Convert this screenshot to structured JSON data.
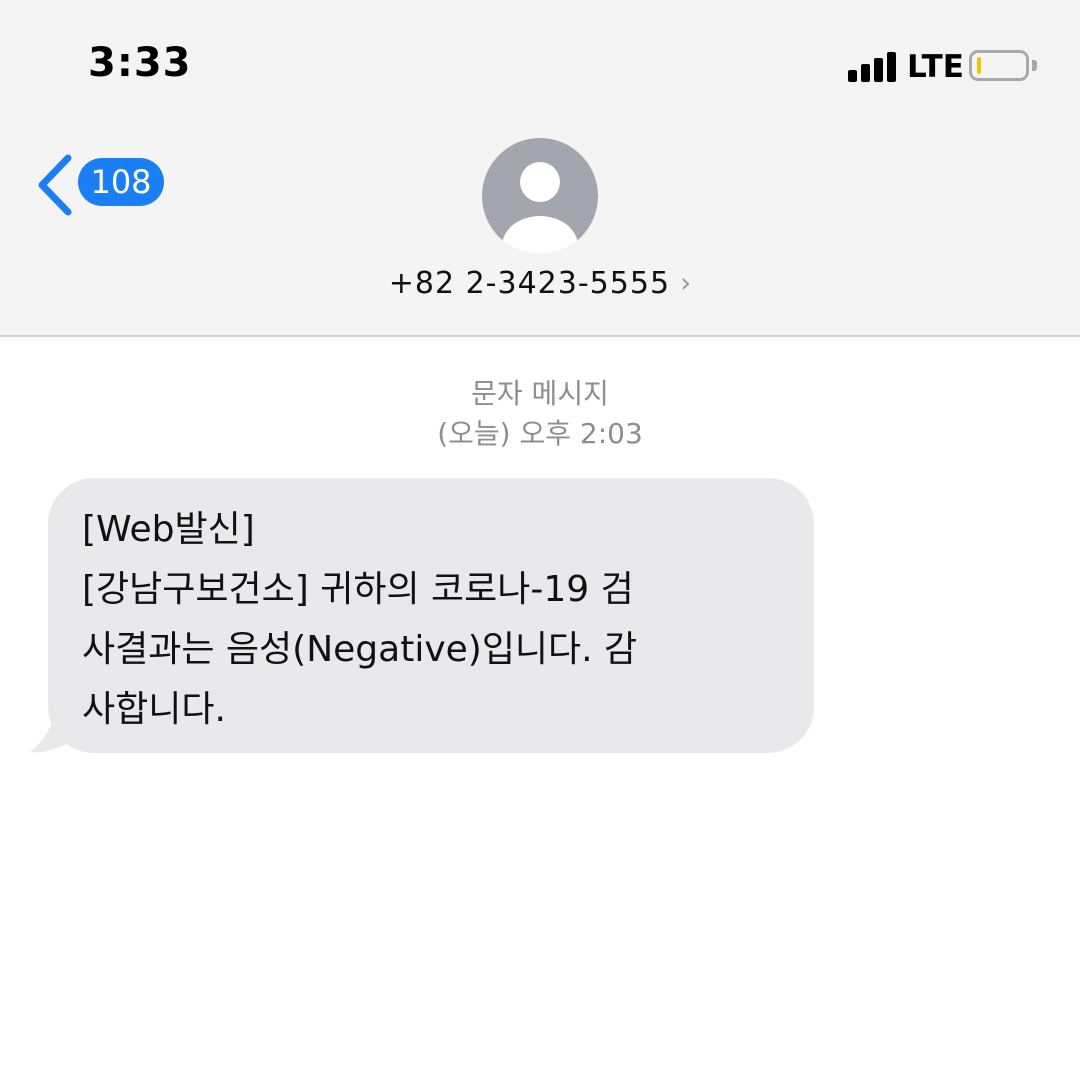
{
  "status_bar": {
    "time": "3:33",
    "network": "LTE",
    "signal_bars": 4,
    "battery_level": 0.08,
    "battery_color": "#f5c400"
  },
  "header": {
    "back_icon": "chevron-left-icon",
    "back_badge_count": "108",
    "accent_color": "#1a7ef5",
    "avatar_icon": "person-silhouette-icon",
    "contact_number": "+82 2-3423-5555",
    "contact_chevron": "›"
  },
  "conversation": {
    "message_type": "문자 메시지",
    "timestamp": "(오늘) 오후 2:03",
    "messages": [
      {
        "direction": "incoming",
        "lines": [
          "[Web발신]",
          "[강남구보건소] 귀하의 코로나-19 검",
          "사결과는 음성(Negative)입니다. 감",
          "사합니다."
        ]
      }
    ]
  }
}
